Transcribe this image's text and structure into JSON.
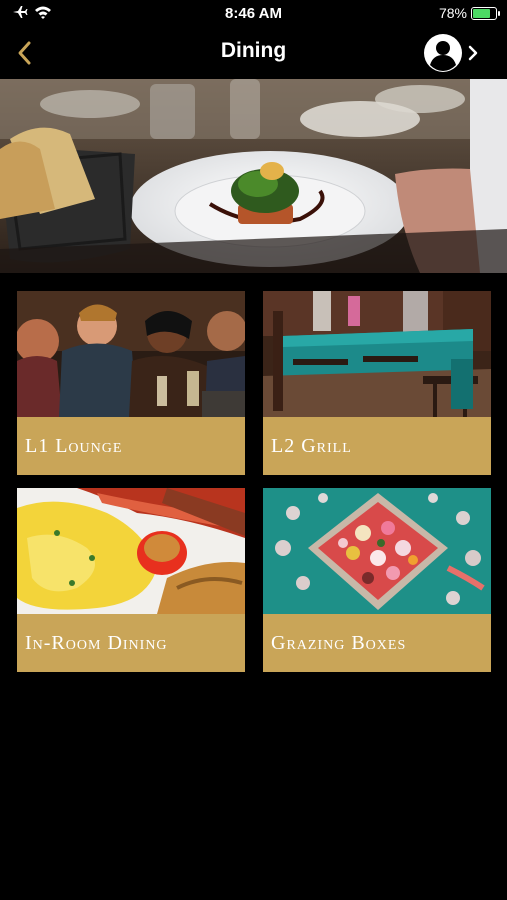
{
  "status_bar": {
    "time": "8:46 AM",
    "battery_percent": "78%",
    "battery_level": 0.78
  },
  "nav": {
    "title": "Dining"
  },
  "colors": {
    "accent_gold": "#c9a558",
    "background": "#000000",
    "battery_green": "#4cd964"
  },
  "tiles": [
    {
      "label": "L1 Lounge"
    },
    {
      "label": "L2 Grill"
    },
    {
      "label": "In-Room Dining"
    },
    {
      "label": "Grazing Boxes"
    }
  ]
}
